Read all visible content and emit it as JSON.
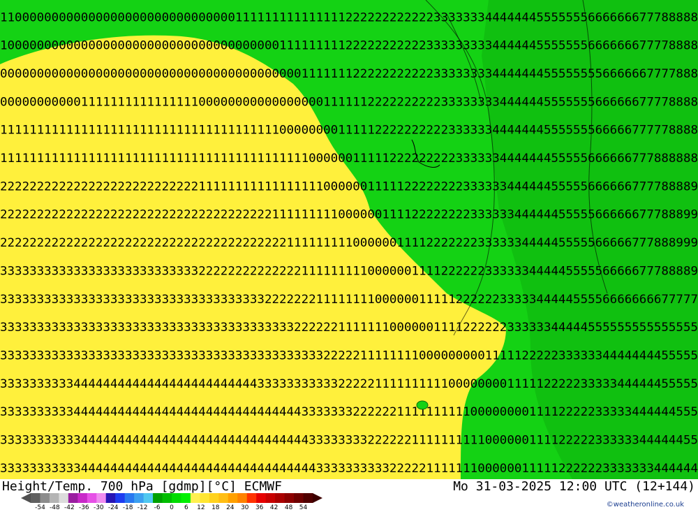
{
  "footer": {
    "title": "Height/Temp. 700 hPa [gdmp][°C] ECMWF",
    "time": "Mo 31-03-2025 12:00 UTC (12+144)",
    "credit": "©weatheronline.co.uk"
  },
  "legend": {
    "ticks": [
      "-54",
      "-48",
      "-42",
      "-36",
      "-30",
      "-24",
      "-18",
      "-12",
      "-6",
      "0",
      "6",
      "12",
      "18",
      "24",
      "30",
      "36",
      "42",
      "48",
      "54"
    ],
    "colors": [
      "#606060",
      "#8c8c8c",
      "#b4b4b4",
      "#dcdcdc",
      "#9a1ea0",
      "#c828c8",
      "#e650e6",
      "#f08cf0",
      "#2814b4",
      "#1e3cf0",
      "#2878f0",
      "#3ca0f0",
      "#50c8f0",
      "#00a000",
      "#00be00",
      "#00dc00",
      "#00f000",
      "#fff050",
      "#ffe632",
      "#ffd21e",
      "#ffbe14",
      "#ffa000",
      "#ff8200",
      "#ff3200",
      "#e60000",
      "#c80000",
      "#aa0000",
      "#8c0000",
      "#6e0000",
      "#500000"
    ],
    "arrow_colors": {
      "left": "#505050",
      "right": "#3c0000"
    }
  },
  "map": {
    "colors": {
      "yellow": "#fff03c",
      "green_light": "#14d214",
      "green_dark": "#0aa00a",
      "glyph": "#000000"
    },
    "field_rows": [
      "11000000000000000000000000000000111111111111111222222222222333333344444445555555666666677788888",
      "10000000000000000000000000000000000000111111111222222222223333333334444445555555666666677778888",
      "00000000000000000000000000000000000000000111111122222222222333333334444444555555556666667777888",
      "00000000000111111111111111100000000000000000111111222222222233333333444444555555566666677778888",
      "11111111111111111111111111111111111111000000001111122222222223333334444444555555566666777778888",
      "11111111111111111111111111111111111111111100000011111222222222333333444444455555666666777888888",
      "22222222222222222222222222211111111111111111000000111112222222233333344444455555666666777788889",
      "22222222222222222222222222222222222221111111110000001111222222223333334444445555566666677788899",
      "22222222222222222222222222222222222222211111111100000011112222222333333444445555566666777888999",
      "33333333333333333333333333322222222222222111111111000000111122222233333344444555556666677788889",
      "33333333333333333333333333333333333322222221111111100000011111222222333334444455556666666677777",
      "33333333333333333333333333333333333333332222221111111000000111122222233333344444555555555555555",
      "33333333333333333333333333333333333333333333222221111111100000000011111222223333334444444455555",
      "33333333334444444444444444444444444333333333332222211111111110000000011111222223333344444455555",
      "33333333334444444444444444444444444444444333333322222211111111110000000011112222233333444444555",
      "33333333333444444444444444444444444444444433333333222222111111111100000011112222233333344444455",
      "33333333333444444444444444444444444444444443333333333222221111111000000111112222223333333444444"
    ]
  }
}
